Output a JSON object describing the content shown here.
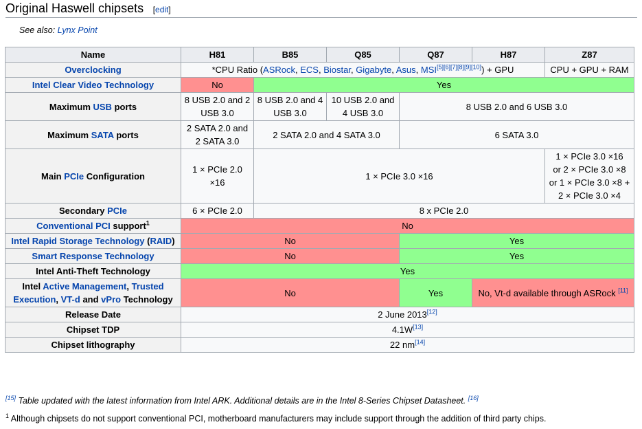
{
  "section": {
    "title": "Original Haswell chipsets",
    "edit_open": "[",
    "edit_label": "edit",
    "edit_close": "]"
  },
  "see_also": {
    "prefix": "See also: ",
    "link": "Lynx Point"
  },
  "table": {
    "header": {
      "name": "Name",
      "cols": [
        "H81",
        "B85",
        "Q85",
        "Q87",
        "H87",
        "Z87"
      ]
    },
    "overclocking": {
      "label": "Overclocking",
      "text_pre": "*CPU Ratio (",
      "links": [
        "ASRock",
        "ECS",
        "Biostar",
        "Gigabyte",
        "Asus",
        "MSI"
      ],
      "refs": "[5][6][7][8][9][10]",
      "text_post": ") + GPU",
      "z87": "CPU + GPU + RAM"
    },
    "clear_video": {
      "label": "Intel Clear Video Technology",
      "no": "No",
      "yes": "Yes"
    },
    "usb": {
      "label_pre": "Maximum ",
      "label_link": "USB",
      "label_post": " ports",
      "h81": "8 USB 2.0 and 2 USB 3.0",
      "b85": "8 USB 2.0 and 4 USB 3.0",
      "q85": "10 USB 2.0 and 4 USB 3.0",
      "rest": "8 USB 2.0 and 6 USB 3.0"
    },
    "sata": {
      "label_pre": "Maximum ",
      "label_link": "SATA",
      "label_post": " ports",
      "h81": "2 SATA 2.0 and 2 SATA 3.0",
      "b85q85": "2 SATA 2.0 and 4 SATA 3.0",
      "rest": "6 SATA 3.0"
    },
    "pcie_main": {
      "label_pre": "Main ",
      "label_link": "PCIe",
      "label_post": " Configuration",
      "h81": "1 × PCIe 2.0 ×16",
      "mid": "1 × PCIe 3.0 ×16",
      "z87_l1": "1 × PCIe 3.0 ×16",
      "z87_l2": "or 2 × PCIe 3.0 ×8",
      "z87_l3": "or 1 × PCIe 3.0 ×8 +",
      "z87_l4": "2 × PCIe 3.0 ×4"
    },
    "pcie_secondary": {
      "label_pre": "Secondary ",
      "label_link": "PCIe",
      "h81": "6 × PCIe 2.0",
      "rest": "8 x PCIe 2.0"
    },
    "conv_pci": {
      "label_link": "Conventional PCI",
      "label_post": " support",
      "sup": "1",
      "value": "No"
    },
    "rst": {
      "label_link1": "Intel Rapid Storage Technology",
      "label_mid": " (",
      "label_link2": "RAID",
      "label_post": ")",
      "no": "No",
      "yes": "Yes"
    },
    "srt": {
      "label": "Smart Response Technology",
      "no": "No",
      "yes": "Yes"
    },
    "anti_theft": {
      "label": "Intel Anti-Theft Technology",
      "value": "Yes"
    },
    "amt": {
      "label_pre": "Intel ",
      "link1": "Active Management",
      "sep1": ", ",
      "link2": "Trusted Execution",
      "sep2": ", ",
      "link3": "VT-d",
      "sep3": " and ",
      "link4": "vPro",
      "label_post": " Technology",
      "no": "No",
      "yes": "Yes",
      "h87z87": "No, Vt-d available through ASRock ",
      "ref": "[11]"
    },
    "release": {
      "label": "Release Date",
      "value": "2 June 2013",
      "ref": "[12]"
    },
    "tdp": {
      "label": "Chipset TDP",
      "value": "4.1W",
      "ref": "[13]"
    },
    "litho": {
      "label": "Chipset lithography",
      "value": "22 nm",
      "ref": "[14]"
    }
  },
  "notes": {
    "note1_ref": "[15]",
    "note1_text": " Table updated with the latest information from Intel ARK. Additional details are in the Intel 8-Series Chipset Datasheet. ",
    "note1_ref2": "[16]",
    "note2_sup": "1",
    "note2_text": " Although chipsets do not support conventional PCI, motherboard manufacturers may include support through the addition of third party chips."
  },
  "colors": {
    "no": "#ff9090",
    "yes": "#90ff90",
    "link": "#0645ad",
    "header_bg": "#eaecf0"
  }
}
